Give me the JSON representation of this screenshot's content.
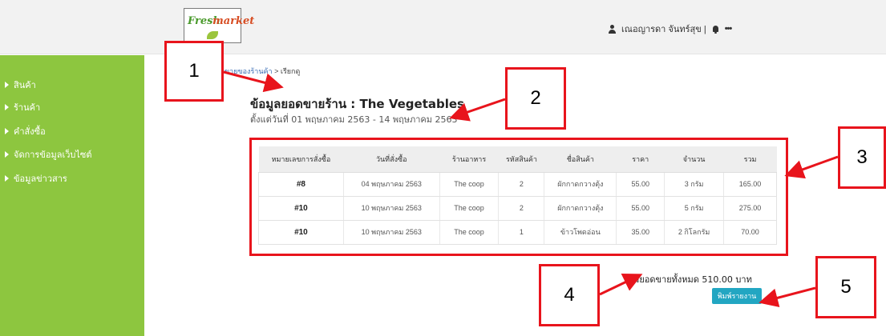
{
  "header": {
    "logo_word1": "Fresh",
    "logo_word2": "market",
    "user_name": "เณอญารดา จันทร์สุข |",
    "more": "•••"
  },
  "sidebar": {
    "items": [
      {
        "label": "สินค้า"
      },
      {
        "label": "ร้านค้า"
      },
      {
        "label": "คำสั่งซื้อ"
      },
      {
        "label": "จัดการข้อมูลเว็บไซต์"
      },
      {
        "label": "ข้อมูลข่าวสาร"
      }
    ]
  },
  "breadcrumb": {
    "link": "...ยอดขายของร้านค้า",
    "separator": ">",
    "current": "เรียกดู"
  },
  "main": {
    "title": "ข้อมูลยอดขายร้าน : The Vegetables",
    "date_range": "ตั้งแต่วันที่ 01 พฤษภาคม 2563 - 14 พฤษภาคม 2563"
  },
  "table": {
    "headers": [
      "หมายเลขการสั่งซื้อ",
      "วันที่สั่งซื้อ",
      "ร้านอาหาร",
      "รหัสสินค้า",
      "ชื่อสินค้า",
      "ราคา",
      "จำนวน",
      "รวม"
    ],
    "rows": [
      [
        "#8",
        "04 พฤษภาคม 2563",
        "The coop",
        "2",
        "ผักกาดกวางตุ้ง",
        "55.00",
        "3 กรัม",
        "165.00"
      ],
      [
        "#10",
        "10 พฤษภาคม 2563",
        "The coop",
        "2",
        "ผักกาดกวางตุ้ง",
        "55.00",
        "5 กรัม",
        "275.00"
      ],
      [
        "#10",
        "10 พฤษภาคม 2563",
        "The coop",
        "1",
        "ข้าวโพดอ่อน",
        "35.00",
        "2 กิโลกรัม",
        "70.00"
      ]
    ]
  },
  "summary": {
    "total_text": "รวมยอดขายทั้งหมด 510.00 บาท",
    "print_label": "พิมพ์รายงาน"
  },
  "callouts": [
    "1",
    "2",
    "3",
    "4",
    "5"
  ],
  "colors": {
    "sidebar": "#8dc63f",
    "annotation": "#e8141c",
    "print_button": "#22a6c2"
  }
}
